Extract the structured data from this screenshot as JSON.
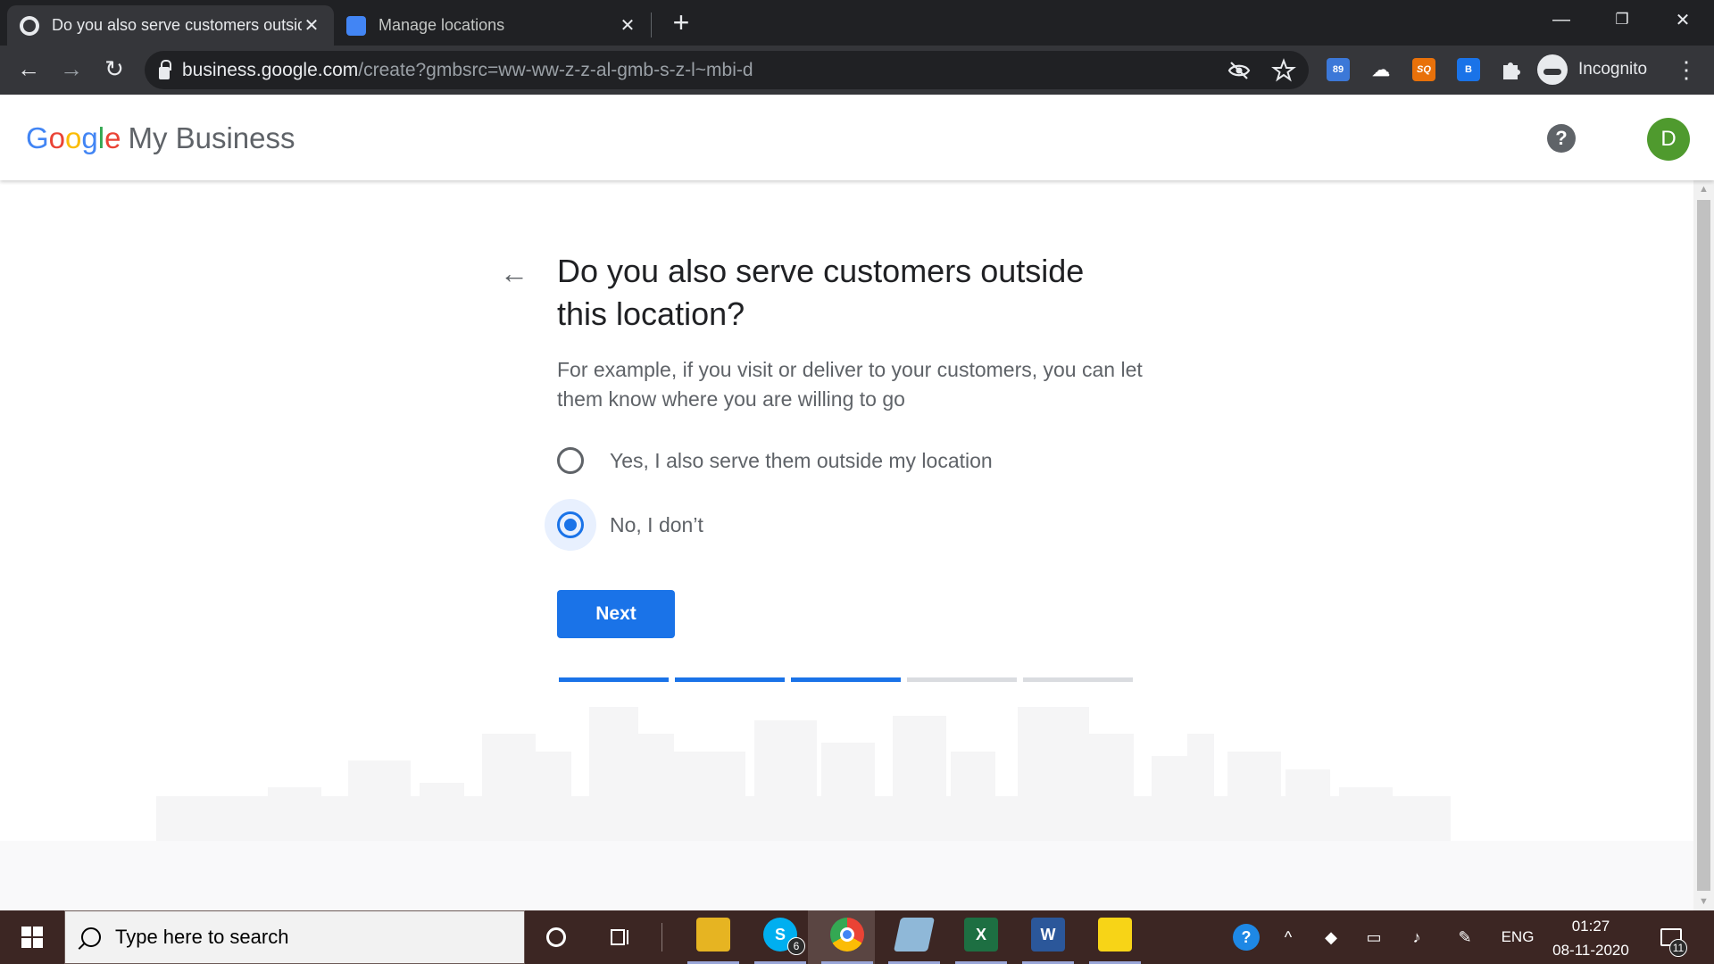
{
  "browser": {
    "tabs": [
      {
        "title": "Do you also serve customers outside this location?",
        "active": true
      },
      {
        "title": "Manage locations",
        "active": false
      }
    ],
    "new_tab": "+",
    "window_controls": {
      "minimize": "—",
      "restore": "❐",
      "close": "✕"
    },
    "tab_close": "✕",
    "url_host": "business.google.com",
    "url_path": "/create?gmbsrc=ww-ww-z-z-al-gmb-s-z-l~mbi-d",
    "nav": {
      "back": "←",
      "forward": "→",
      "reload": "↻"
    },
    "extensions": [
      {
        "name": "ext-89-icon",
        "label": "89",
        "color": "#3c78d8"
      },
      {
        "name": "ext-cloud-icon",
        "label": "☁",
        "color": "#5f6368"
      },
      {
        "name": "ext-sq-icon",
        "label": "SQ",
        "color": "#e8710a"
      },
      {
        "name": "ext-doc-icon",
        "label": "B",
        "color": "#1a73e8"
      }
    ],
    "profile_label": "Incognito",
    "menu": "⋮"
  },
  "app": {
    "logo": {
      "g": "G",
      "o1": "o",
      "o2": "o",
      "g2": "g",
      "l": "l",
      "e": "e",
      "product": "My Business"
    },
    "help": "?",
    "account_initial": "D"
  },
  "page": {
    "question": "Do you also serve customers outside this location?",
    "subtext": "For example, if you visit or deliver to your customers, you can let them know where you are willing to go",
    "options": [
      {
        "label": "Yes, I also serve them outside my location",
        "selected": false
      },
      {
        "label": "No, I don’t",
        "selected": true
      }
    ],
    "next_label": "Next",
    "progress": {
      "completed_steps": 3,
      "total_steps": 5
    }
  },
  "taskbar": {
    "search_placeholder": "Type here to search",
    "skype_badge": "6",
    "language": "ENG",
    "time": "01:27",
    "date": "08-11-2020",
    "notification_count": "11"
  },
  "colors": {
    "accent": "#1a73e8",
    "avatar": "#4f9a2e",
    "taskbar": "#3c2623"
  }
}
